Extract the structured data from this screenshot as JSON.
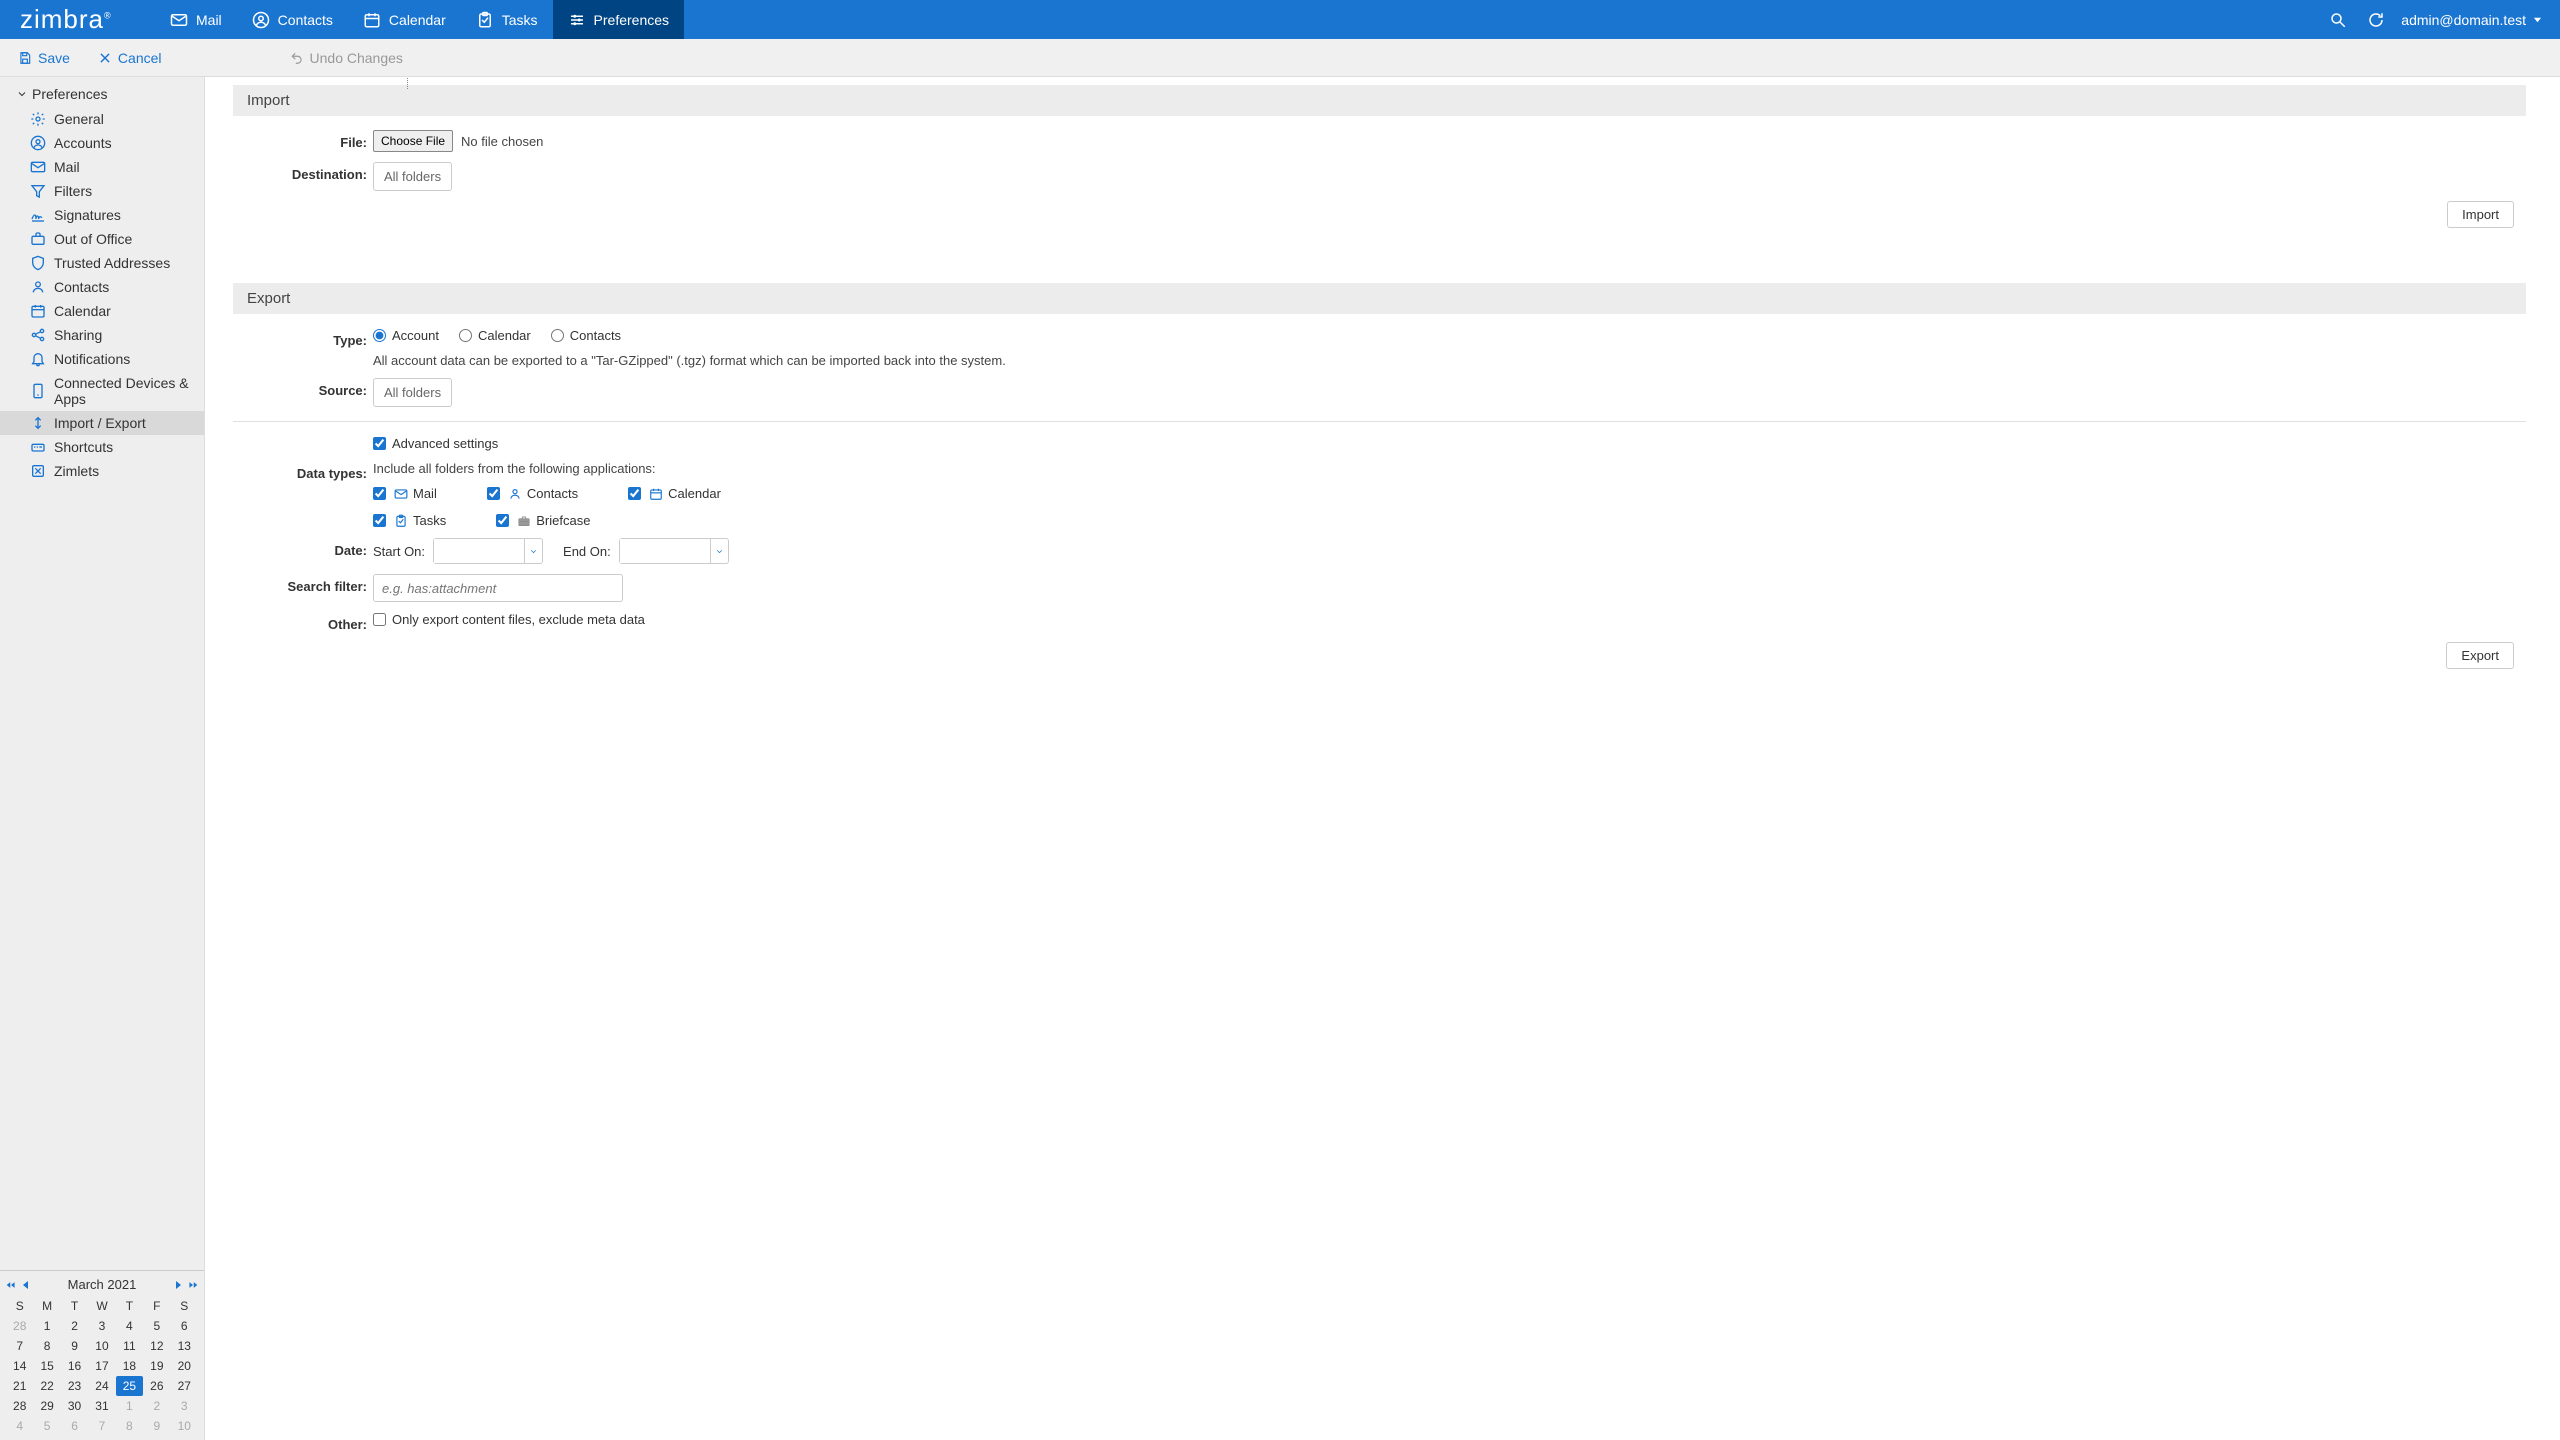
{
  "header": {
    "logo_text": "zimbra",
    "tabs": [
      {
        "id": "mail",
        "label": "Mail"
      },
      {
        "id": "contacts",
        "label": "Contacts"
      },
      {
        "id": "calendar",
        "label": "Calendar"
      },
      {
        "id": "tasks",
        "label": "Tasks"
      },
      {
        "id": "preferences",
        "label": "Preferences"
      }
    ],
    "user_email": "admin@domain.test"
  },
  "toolbar": {
    "save_label": "Save",
    "cancel_label": "Cancel",
    "undo_label": "Undo Changes"
  },
  "sidebar": {
    "root_label": "Preferences",
    "items": [
      {
        "id": "general",
        "label": "General",
        "icon": "gear"
      },
      {
        "id": "accounts",
        "label": "Accounts",
        "icon": "person-circle"
      },
      {
        "id": "mail",
        "label": "Mail",
        "icon": "mail"
      },
      {
        "id": "filters",
        "label": "Filters",
        "icon": "filter"
      },
      {
        "id": "signatures",
        "label": "Signatures",
        "icon": "signature"
      },
      {
        "id": "out-of-office",
        "label": "Out of Office",
        "icon": "suitcase"
      },
      {
        "id": "trusted-addresses",
        "label": "Trusted Addresses",
        "icon": "shield"
      },
      {
        "id": "contacts",
        "label": "Contacts",
        "icon": "contacts"
      },
      {
        "id": "calendar",
        "label": "Calendar",
        "icon": "calendar"
      },
      {
        "id": "sharing",
        "label": "Sharing",
        "icon": "share"
      },
      {
        "id": "notifications",
        "label": "Notifications",
        "icon": "bell"
      },
      {
        "id": "connected-devices",
        "label": "Connected Devices & Apps",
        "icon": "device"
      },
      {
        "id": "import-export",
        "label": "Import / Export",
        "icon": "import-export"
      },
      {
        "id": "shortcuts",
        "label": "Shortcuts",
        "icon": "shortcuts"
      },
      {
        "id": "zimlets",
        "label": "Zimlets",
        "icon": "zimlet"
      }
    ],
    "selected": "import-export"
  },
  "minical": {
    "title": "March 2021",
    "dow": [
      "S",
      "M",
      "T",
      "W",
      "T",
      "F",
      "S"
    ],
    "weeks": [
      [
        {
          "d": "28",
          "dim": true
        },
        {
          "d": "1"
        },
        {
          "d": "2"
        },
        {
          "d": "3"
        },
        {
          "d": "4"
        },
        {
          "d": "5"
        },
        {
          "d": "6"
        }
      ],
      [
        {
          "d": "7"
        },
        {
          "d": "8"
        },
        {
          "d": "9"
        },
        {
          "d": "10"
        },
        {
          "d": "11"
        },
        {
          "d": "12"
        },
        {
          "d": "13"
        }
      ],
      [
        {
          "d": "14"
        },
        {
          "d": "15"
        },
        {
          "d": "16"
        },
        {
          "d": "17"
        },
        {
          "d": "18"
        },
        {
          "d": "19"
        },
        {
          "d": "20"
        }
      ],
      [
        {
          "d": "21"
        },
        {
          "d": "22"
        },
        {
          "d": "23"
        },
        {
          "d": "24"
        },
        {
          "d": "25",
          "today": true
        },
        {
          "d": "26"
        },
        {
          "d": "27"
        }
      ],
      [
        {
          "d": "28"
        },
        {
          "d": "29"
        },
        {
          "d": "30"
        },
        {
          "d": "31"
        },
        {
          "d": "1",
          "dim": true
        },
        {
          "d": "2",
          "dim": true
        },
        {
          "d": "3",
          "dim": true
        }
      ],
      [
        {
          "d": "4",
          "dim": true
        },
        {
          "d": "5",
          "dim": true
        },
        {
          "d": "6",
          "dim": true
        },
        {
          "d": "7",
          "dim": true
        },
        {
          "d": "8",
          "dim": true
        },
        {
          "d": "9",
          "dim": true
        },
        {
          "d": "10",
          "dim": true
        }
      ]
    ]
  },
  "content": {
    "import": {
      "title": "Import",
      "file_label": "File:",
      "choose_file": "Choose File",
      "file_status": "No file chosen",
      "destination_label": "Destination:",
      "destination_value": "All folders",
      "import_btn": "Import"
    },
    "export": {
      "title": "Export",
      "type_label": "Type:",
      "type_options": {
        "account": "Account",
        "calendar": "Calendar",
        "contacts": "Contacts"
      },
      "type_desc": "All account data can be exported to a \"Tar-GZipped\" (.tgz) format which can be imported back into the system.",
      "source_label": "Source:",
      "source_value": "All folders",
      "advanced_label": "Advanced settings",
      "datatypes_label": "Data types:",
      "datatypes_desc": "Include all folders from the following applications:",
      "apps": {
        "mail": "Mail",
        "contacts": "Contacts",
        "calendar": "Calendar",
        "tasks": "Tasks",
        "briefcase": "Briefcase"
      },
      "date_label": "Date:",
      "start_on": "Start On:",
      "end_on": "End On:",
      "search_label": "Search filter:",
      "search_placeholder": "e.g. has:attachment",
      "other_label": "Other:",
      "other_option": "Only export content files, exclude meta data",
      "export_btn": "Export"
    }
  }
}
